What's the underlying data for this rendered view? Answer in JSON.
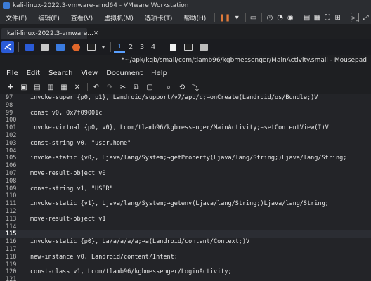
{
  "vmware": {
    "title": "kali-linux-2022.3-vmware-amd64 - VMware Workstation",
    "menus": [
      "文件(F)",
      "编辑(E)",
      "查看(V)",
      "虚拟机(M)",
      "选项卡(T)",
      "帮助(H)"
    ],
    "tab_label": "kali-linux-2022.3-vmware..."
  },
  "kali_panel": {
    "workspaces": [
      "1",
      "2",
      "3",
      "4"
    ],
    "active_workspace": "1"
  },
  "mousepad": {
    "title": "*~/apk/kgb/smali/com/tlamb96/kgbmessenger/MainActivity.smali - Mousepad",
    "menus": [
      "File",
      "Edit",
      "Search",
      "View",
      "Document",
      "Help"
    ]
  },
  "editor": {
    "current_line": "115",
    "lines": [
      {
        "n": "97",
        "code": "invoke-super {p0, p1}, Landroid/support/v7/app/c;→onCreate(Landroid/os/Bundle;)V"
      },
      {
        "n": "98",
        "code": ""
      },
      {
        "n": "99",
        "code": "const v0, 0x7f09001c"
      },
      {
        "n": "100",
        "code": ""
      },
      {
        "n": "101",
        "code": "invoke-virtual {p0, v0}, Lcom/tlamb96/kgbmessenger/MainActivity;→setContentView(I)V"
      },
      {
        "n": "102",
        "code": ""
      },
      {
        "n": "103",
        "code": "const-string v0, \"user.home\""
      },
      {
        "n": "104",
        "code": ""
      },
      {
        "n": "105",
        "code": "invoke-static {v0}, Ljava/lang/System;→getProperty(Ljava/lang/String;)Ljava/lang/String;"
      },
      {
        "n": "106",
        "code": ""
      },
      {
        "n": "107",
        "code": "move-result-object v0"
      },
      {
        "n": "108",
        "code": ""
      },
      {
        "n": "109",
        "code": "const-string v1, \"USER\""
      },
      {
        "n": "110",
        "code": ""
      },
      {
        "n": "111",
        "code": "invoke-static {v1}, Ljava/lang/System;→getenv(Ljava/lang/String;)Ljava/lang/String;"
      },
      {
        "n": "112",
        "code": ""
      },
      {
        "n": "113",
        "code": "move-result-object v1"
      },
      {
        "n": "114",
        "code": ""
      },
      {
        "n": "115",
        "code": ""
      },
      {
        "n": "116",
        "code": "invoke-static {p0}, La/a/a/a/a;→a(Landroid/content/Context;)V"
      },
      {
        "n": "117",
        "code": ""
      },
      {
        "n": "118",
        "code": "new-instance v0, Landroid/content/Intent;"
      },
      {
        "n": "119",
        "code": ""
      },
      {
        "n": "120",
        "code": "const-class v1, Lcom/tlamb96/kgbmessenger/LoginActivity;"
      },
      {
        "n": "121",
        "code": ""
      }
    ]
  }
}
